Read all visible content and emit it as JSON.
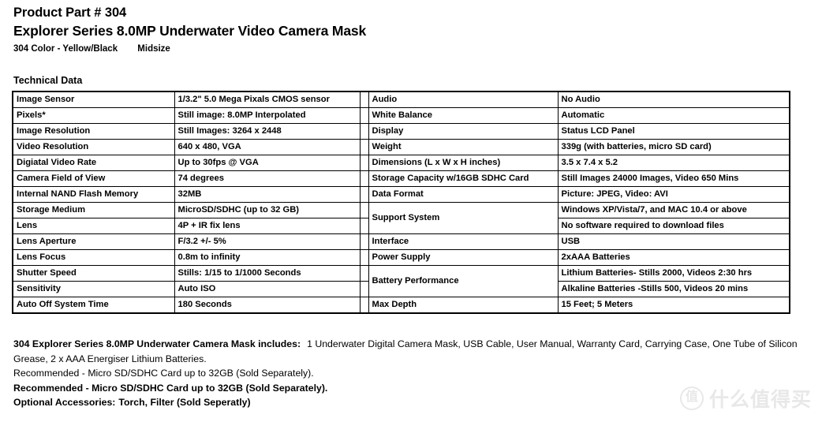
{
  "header": {
    "part_number": "Product Part # 304",
    "title": "Explorer Series 8.0MP Underwater Video Camera Mask",
    "color_line": "304 Color - Yellow/Black",
    "size_line": "Midsize"
  },
  "section_heading": "Technical Data",
  "spec_table": {
    "left": [
      {
        "label": "Image Sensor",
        "value": "1/3.2\" 5.0 Mega Pixals CMOS sensor",
        "shade": "light"
      },
      {
        "label": "Pixels*",
        "value": "Still image: 8.0MP Interpolated",
        "shade": "none"
      },
      {
        "label": "Image Resolution",
        "value": "Still Images: 3264 x 2448",
        "shade": "light"
      },
      {
        "label": "Video Resolution",
        "value": "640 x 480, VGA",
        "shade": "none"
      },
      {
        "label": "Digiatal Video Rate",
        "value": "Up to 30fps @ VGA",
        "shade": "light"
      },
      {
        "label": "Camera Field of View",
        "value": "74 degrees",
        "shade": "none"
      },
      {
        "label": "Internal NAND Flash Memory",
        "value": "32MB",
        "shade": "light"
      },
      {
        "label": "Storage Medium",
        "value": "MicroSD/SDHC (up to 32 GB)",
        "shade": "none"
      },
      {
        "label": "Lens",
        "value": "4P + IR fix lens",
        "shade": "dark"
      },
      {
        "label": "Lens Aperture",
        "value": "F/3.2  +/- 5%",
        "shade": "none"
      },
      {
        "label": "Lens Focus",
        "value": "0.8m to infinity",
        "shade": "light"
      },
      {
        "label": "Shutter Speed",
        "value": "Stills: 1/15 to 1/1000 Seconds",
        "shade": "none"
      },
      {
        "label": "Sensitivity",
        "value": "Auto ISO",
        "shade": "light"
      },
      {
        "label": "Auto Off System Time",
        "value": "180 Seconds",
        "shade": "none"
      }
    ],
    "right": [
      {
        "label": "Audio",
        "value": "No Audio",
        "shade": "light"
      },
      {
        "label": "White Balance",
        "value": "Automatic",
        "shade": "none"
      },
      {
        "label": "Display",
        "value": "Status LCD Panel",
        "shade": "light"
      },
      {
        "label": "Weight",
        "value": "339g (with batteries, micro SD card)",
        "shade": "none"
      },
      {
        "label": "Dimensions (L x W x H inches)",
        "value": "3.5 x 7.4 x 5.2",
        "shade": "light"
      },
      {
        "label": "Storage Capacity w/16GB SDHC Card",
        "value": "Still Images 24000 Images, Video 650 Mins",
        "shade": "none"
      },
      {
        "label": "Data Format",
        "value": "Picture: JPEG, Video: AVI",
        "shade": "light"
      },
      {
        "label": "Support System",
        "value": "Windows XP/Vista/7, and MAC 10.4 or above",
        "value2": "No software required to download files",
        "shade": "none",
        "merged": true
      },
      {
        "label": "Interface",
        "value": "USB",
        "shade": "light"
      },
      {
        "label": "Power Supply",
        "value": "2xAAA Batteries",
        "shade": "none"
      },
      {
        "label": "Battery Performance",
        "value": "Lithium Batteries- Stills 2000, Videos 2:30 hrs",
        "value2": "Alkaline Batteries -Stills 500, Videos 20 mins",
        "shade": "light",
        "merged": true
      },
      {
        "label": "Max Depth",
        "value": "15 Feet; 5 Meters",
        "shade": "none"
      }
    ]
  },
  "footer": {
    "includes_label": "304 Explorer Series 8.0MP Underwater Camera Mask includes:",
    "includes_text": "1 Underwater Digital Camera Mask, USB Cable, User Manual, Warranty Card, Carrying Case, One Tube of Silicon Grease, 2 x AAA Energiser Lithium Batteries.",
    "recommended_regular": "Recommended - Micro SD/SDHC Card up to 32GB (Sold Separately).",
    "recommended_bold": "Recommended - Micro SD/SDHC Card up to 32GB (Sold Separately).",
    "optional_label": "Optional Accessories:",
    "optional_text": "Torch, Filter (Sold Seperatly)"
  },
  "watermark": {
    "logo_glyph": "值",
    "text": "什么值得买"
  }
}
